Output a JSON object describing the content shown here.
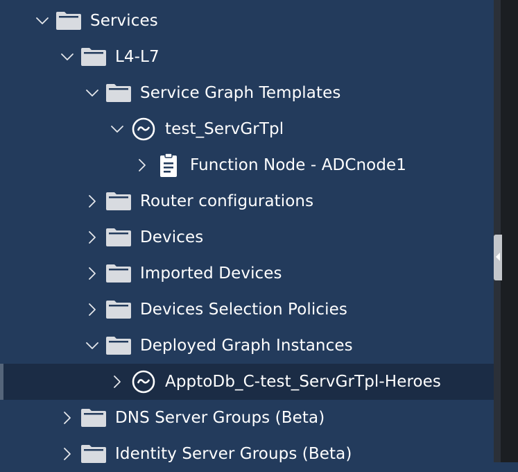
{
  "tree": {
    "items": [
      {
        "label": "Services",
        "depth": 0,
        "expanded": true,
        "icon": "folder-icon"
      },
      {
        "label": "L4-L7",
        "depth": 1,
        "expanded": true,
        "icon": "folder-icon"
      },
      {
        "label": "Service Graph Templates",
        "depth": 2,
        "expanded": true,
        "icon": "folder-icon"
      },
      {
        "label": "test_ServGrTpl",
        "depth": 3,
        "expanded": true,
        "icon": "service-graph-icon"
      },
      {
        "label": "Function Node - ADCnode1",
        "depth": 4,
        "expanded": false,
        "icon": "document-icon"
      },
      {
        "label": "Router configurations",
        "depth": 2,
        "expanded": false,
        "icon": "folder-icon"
      },
      {
        "label": "Devices",
        "depth": 2,
        "expanded": false,
        "icon": "folder-icon"
      },
      {
        "label": "Imported Devices",
        "depth": 2,
        "expanded": false,
        "icon": "folder-icon"
      },
      {
        "label": "Devices Selection Policies",
        "depth": 2,
        "expanded": false,
        "icon": "folder-icon"
      },
      {
        "label": "Deployed Graph Instances",
        "depth": 2,
        "expanded": true,
        "icon": "folder-icon"
      },
      {
        "label": "ApptoDb_C-test_ServGrTpl-Heroes",
        "depth": 3,
        "expanded": false,
        "icon": "service-graph-icon",
        "selected": true
      },
      {
        "label": "DNS Server Groups (Beta)",
        "depth": 1,
        "expanded": false,
        "icon": "folder-icon"
      },
      {
        "label": "Identity Server Groups (Beta)",
        "depth": 1,
        "expanded": false,
        "icon": "folder-icon"
      }
    ]
  },
  "colors": {
    "background": "#233b5c",
    "selected_row": "#1b2c45",
    "icon": "#d8dbe0",
    "text": "#ffffff"
  }
}
